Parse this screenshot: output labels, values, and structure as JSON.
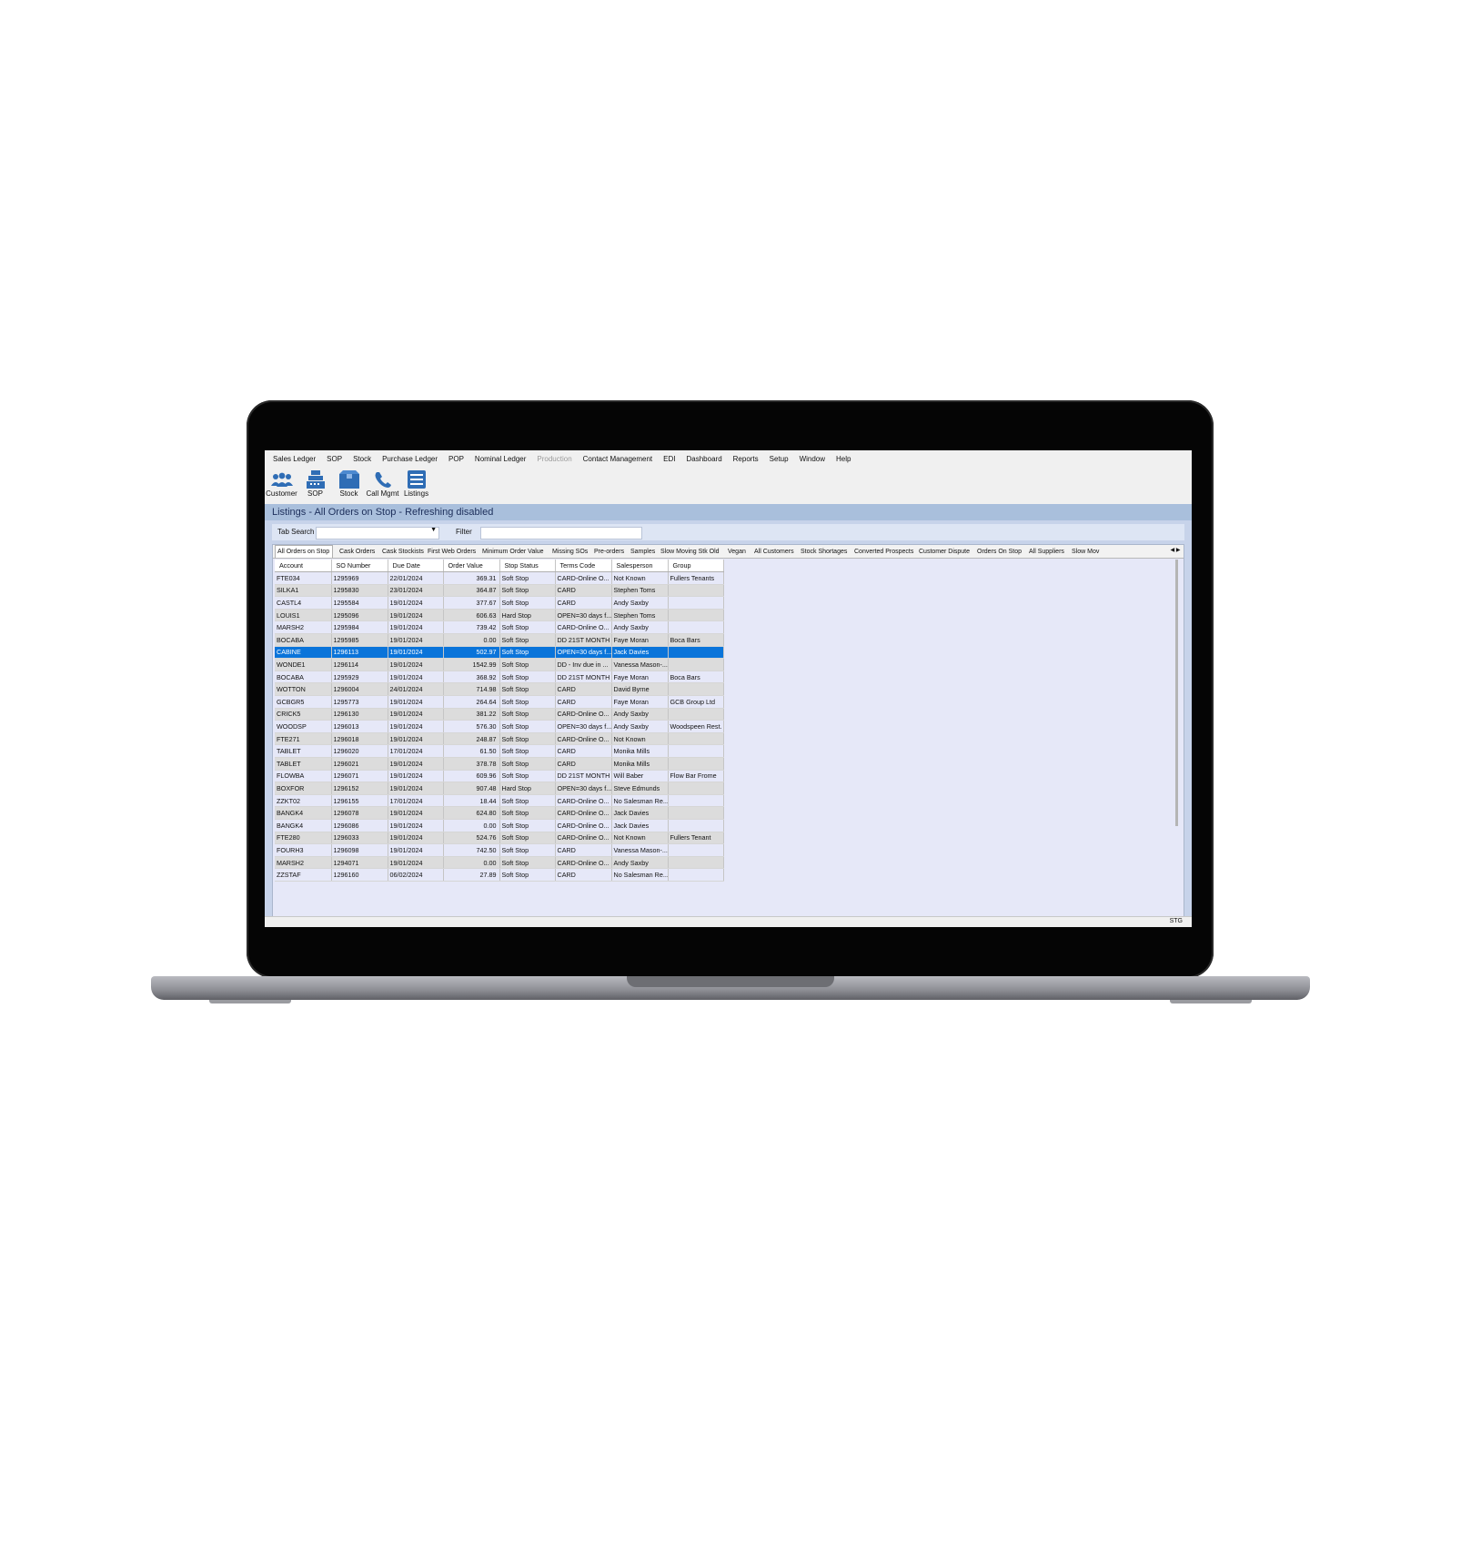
{
  "menu": [
    "Sales Ledger",
    "SOP",
    "Stock",
    "Purchase Ledger",
    "POP",
    "Nominal Ledger",
    "Production",
    "Contact Management",
    "EDI",
    "Dashboard",
    "Reports",
    "Setup",
    "Window",
    "Help"
  ],
  "menu_disabled": [
    "Production"
  ],
  "toolbar": [
    {
      "label": "Customer",
      "icon": "customer-icon"
    },
    {
      "label": "SOP",
      "icon": "sop-icon"
    },
    {
      "label": "Stock",
      "icon": "stock-icon"
    },
    {
      "label": "Call Mgmt",
      "icon": "call-icon"
    },
    {
      "label": "Listings",
      "icon": "listings-icon"
    }
  ],
  "window_title": "Listings - All Orders on Stop - Refreshing disabled",
  "search": {
    "tab_search_label": "Tab Search",
    "tab_search_value": "",
    "filter_label": "Filter",
    "filter_value": ""
  },
  "tabs": [
    "All Orders on Stop",
    "Cask Orders",
    "Cask Stockists",
    "First Web Orders",
    "Minimum Order Value",
    "Missing SOs",
    "Pre-orders",
    "Samples",
    "Slow Moving Stk Old",
    "Vegan",
    "All Customers",
    "Stock Shortages",
    "Converted Prospects",
    "Customer Dispute",
    "Orders On Stop",
    "All Suppliers",
    "Slow Mov"
  ],
  "active_tab": "All Orders on Stop",
  "columns": [
    "Account",
    "SO Number",
    "Due Date",
    "Order Value",
    "Stop Status",
    "Terms Code",
    "Salesperson",
    "Group"
  ],
  "rows": [
    [
      "FTE034",
      "1295969",
      "22/01/2024",
      "369.31",
      "Soft Stop",
      "CARD-Online O...",
      "Not Known",
      "Fullers Tenants"
    ],
    [
      "SILKA1",
      "1295830",
      "23/01/2024",
      "364.87",
      "Soft Stop",
      "CARD",
      "Stephen Toms",
      ""
    ],
    [
      "CASTL4",
      "1295584",
      "19/01/2024",
      "377.67",
      "Soft Stop",
      "CARD",
      "Andy Saxby",
      ""
    ],
    [
      "LOUIS1",
      "1295096",
      "19/01/2024",
      "606.63",
      "Hard Stop",
      "OPEN=30 days f...",
      "Stephen Toms",
      ""
    ],
    [
      "MARSH2",
      "1295984",
      "19/01/2024",
      "739.42",
      "Soft Stop",
      "CARD-Online O...",
      "Andy Saxby",
      ""
    ],
    [
      "BOCABA",
      "1295985",
      "19/01/2024",
      "0.00",
      "Soft Stop",
      "DD 21ST MONTH",
      "Faye Moran",
      "Boca Bars"
    ],
    [
      "CABINE",
      "1296113",
      "19/01/2024",
      "502.97",
      "Soft Stop",
      "OPEN=30 days f...",
      "Jack Davies",
      ""
    ],
    [
      "WONDE1",
      "1296114",
      "19/01/2024",
      "1542.99",
      "Soft Stop",
      "DD - Inv due in ...",
      "Vanessa Mason-...",
      ""
    ],
    [
      "BOCABA",
      "1295929",
      "19/01/2024",
      "368.92",
      "Soft Stop",
      "DD 21ST MONTH",
      "Faye Moran",
      "Boca Bars"
    ],
    [
      "WOTTON",
      "1296004",
      "24/01/2024",
      "714.98",
      "Soft Stop",
      "CARD",
      "David Byrne",
      ""
    ],
    [
      "GCBGR5",
      "1295773",
      "19/01/2024",
      "264.64",
      "Soft Stop",
      "CARD",
      "Faye Moran",
      "GCB Group Ltd"
    ],
    [
      "CRICK5",
      "1296130",
      "19/01/2024",
      "381.22",
      "Soft Stop",
      "CARD-Online O...",
      "Andy Saxby",
      ""
    ],
    [
      "WOODSP",
      "1296013",
      "19/01/2024",
      "576.30",
      "Soft Stop",
      "OPEN=30 days f...",
      "Andy Saxby",
      "Woodspeen Rest."
    ],
    [
      "FTE271",
      "1296018",
      "19/01/2024",
      "248.87",
      "Soft Stop",
      "CARD-Online O...",
      "Not Known",
      ""
    ],
    [
      "TABLET",
      "1296020",
      "17/01/2024",
      "61.50",
      "Soft Stop",
      "CARD",
      "Monika Mills",
      ""
    ],
    [
      "TABLET",
      "1296021",
      "19/01/2024",
      "378.78",
      "Soft Stop",
      "CARD",
      "Monika Mills",
      ""
    ],
    [
      "FLOWBA",
      "1296071",
      "19/01/2024",
      "609.96",
      "Soft Stop",
      "DD 21ST MONTH",
      "Will Baber",
      "Flow Bar Frome"
    ],
    [
      "BOXFOR",
      "1296152",
      "19/01/2024",
      "907.48",
      "Hard Stop",
      "OPEN=30 days f...",
      "Steve Edmunds",
      ""
    ],
    [
      "ZZKT02",
      "1296155",
      "17/01/2024",
      "18.44",
      "Soft Stop",
      "CARD-Online O...",
      "No Salesman Re...",
      ""
    ],
    [
      "BANGK4",
      "1296078",
      "19/01/2024",
      "624.80",
      "Soft Stop",
      "CARD-Online O...",
      "Jack Davies",
      ""
    ],
    [
      "BANGK4",
      "1296086",
      "19/01/2024",
      "0.00",
      "Soft Stop",
      "CARD-Online O...",
      "Jack Davies",
      ""
    ],
    [
      "FTE280",
      "1296033",
      "19/01/2024",
      "524.76",
      "Soft Stop",
      "CARD-Online O...",
      "Not Known",
      "Fullers Tenant"
    ],
    [
      "FOURH3",
      "1296098",
      "19/01/2024",
      "742.50",
      "Soft Stop",
      "CARD",
      "Vanessa Mason-...",
      ""
    ],
    [
      "MARSH2",
      "1294071",
      "19/01/2024",
      "0.00",
      "Soft Stop",
      "CARD-Online O...",
      "Andy Saxby",
      ""
    ],
    [
      "ZZSTAF",
      "1296160",
      "06/02/2024",
      "27.89",
      "Soft Stop",
      "CARD",
      "No Salesman Re...",
      ""
    ]
  ],
  "selected_row": 6,
  "status_text": "STG",
  "colors": {
    "selected": "#0a74da",
    "title_bar": "#a9bfdc",
    "panel": "#c7d3ea",
    "grid_odd": "#e6e8f8",
    "grid_even": "#dcdcdc",
    "icon": "#2f6db5"
  }
}
